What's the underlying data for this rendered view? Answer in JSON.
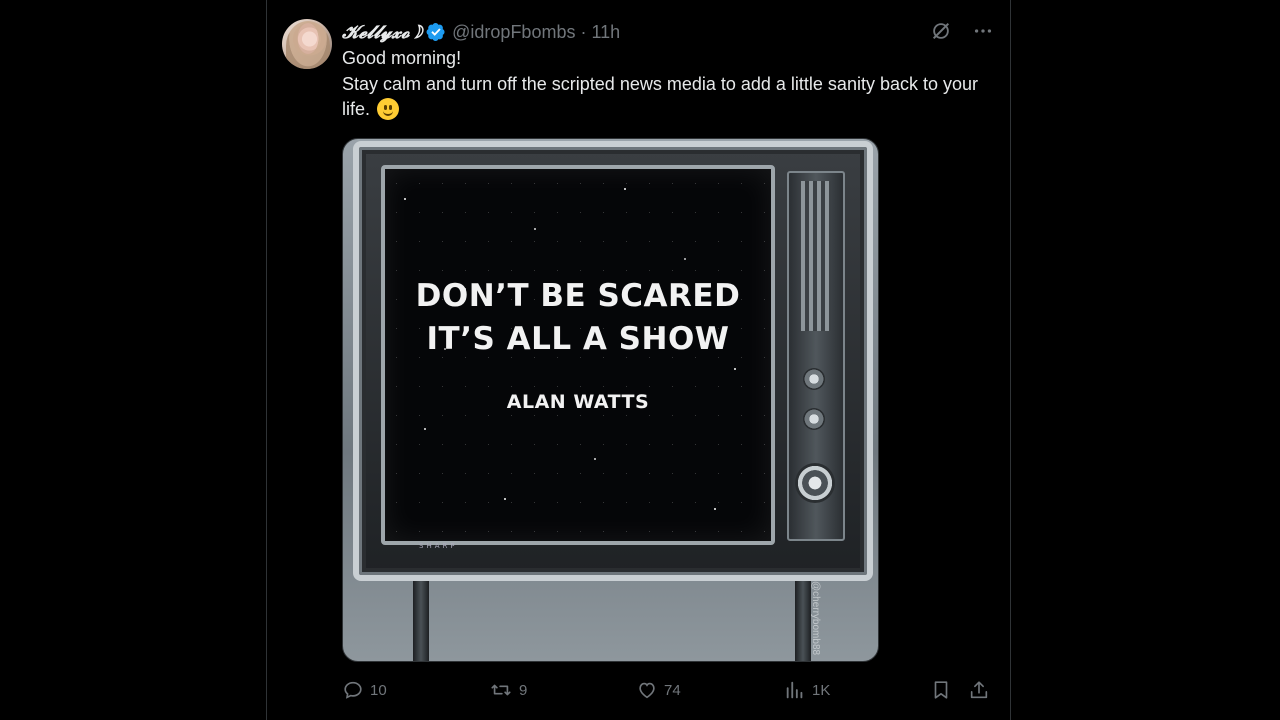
{
  "tweet": {
    "display_name": "𝓚𝓮𝓵𝓵𝔂𝔁𝓸☽",
    "handle": "@idropFbombs",
    "separator": "·",
    "time": "11h",
    "text_line1": "Good morning!",
    "text_line2": "Stay calm and turn off the scripted news media to add a little sanity back to your life.",
    "emoji": "slightly-smiling-face"
  },
  "media": {
    "quote_line1": "DON’T BE SCARED",
    "quote_line2": "IT’S ALL A SHOW",
    "author": "ALAN WATTS",
    "brand": "SHARP",
    "watermark": "@cherrybomb88"
  },
  "actions": {
    "replies": "10",
    "reposts": "9",
    "likes": "74",
    "views": "1K"
  },
  "colors": {
    "background": "#000000",
    "text": "#e7e9ea",
    "muted": "#71767b",
    "verified": "#1d9bf0"
  }
}
